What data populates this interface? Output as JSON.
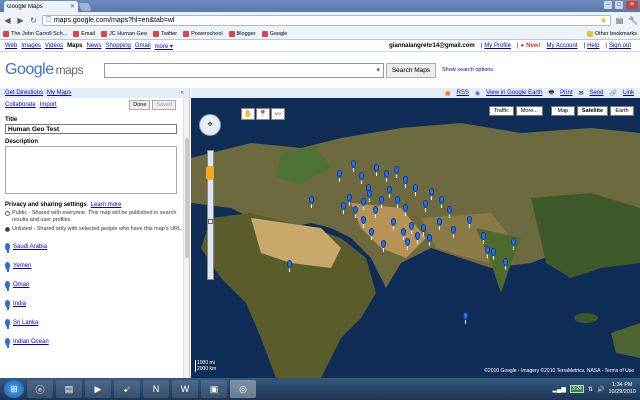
{
  "browser": {
    "tab_title": "Google Maps",
    "url": "maps.google.com/maps?hl=en&tab=wl"
  },
  "bookmarks": [
    {
      "label": "The John Carroll Sch..."
    },
    {
      "label": "Email"
    },
    {
      "label": "JC Human Geo"
    },
    {
      "label": "Twitter"
    },
    {
      "label": "Powerschool"
    },
    {
      "label": "Blogger"
    },
    {
      "label": "Google"
    }
  ],
  "other_bookmarks": "Other bookmarks",
  "gbar": {
    "links": [
      "Web",
      "Images",
      "Videos"
    ],
    "current": "Maps",
    "links2": [
      "News",
      "Shopping",
      "Gmail",
      "more ▾"
    ],
    "user": "giannalangrehr14@gmail.com",
    "my_profile": "My Profile",
    "new": "New!",
    "my_account": "My Account",
    "help": "Help",
    "sign_out": "Sign out"
  },
  "search": {
    "logo_google": "Google",
    "logo_maps": "maps",
    "button": "Search Maps",
    "options": "Show search options"
  },
  "left_panel": {
    "get_directions": "Get Directions",
    "my_maps": "My Maps",
    "collaborate": "Collaborate",
    "import": "Import",
    "done": "Done",
    "saved": "Saved",
    "title_label": "Title",
    "title_value": "Human Geo Test",
    "description_label": "Description",
    "privacy_label": "Privacy and sharing settings",
    "learn_more": "Learn more",
    "public_text": "Public - Shared with everyone. This map will be published in search results and user profiles.",
    "unlisted_text": "Unlisted - Shared only with selected people who have this map's URL.",
    "places": [
      "Saudi Arabia",
      "Yemen",
      "Oman",
      "India",
      "Sri Lanka",
      "Indian Ocean"
    ]
  },
  "map": {
    "rss": "RSS",
    "view_earth": "View in Google Earth",
    "print": "Print",
    "send": "Send",
    "link": "Link",
    "traffic": "Traffic",
    "more": "More...",
    "map_type": "Map",
    "satellite": "Satellite",
    "earth": "Earth",
    "scale_mi": "1000 mi",
    "scale_km": "2000 km",
    "copyright": "©2010 Google - Imagery ©2010 TerraMetrics, NASA - Terms of Use"
  },
  "taskbar": {
    "time": "1:34 PM",
    "date": "10/29/2010",
    "meter": "3:24"
  }
}
